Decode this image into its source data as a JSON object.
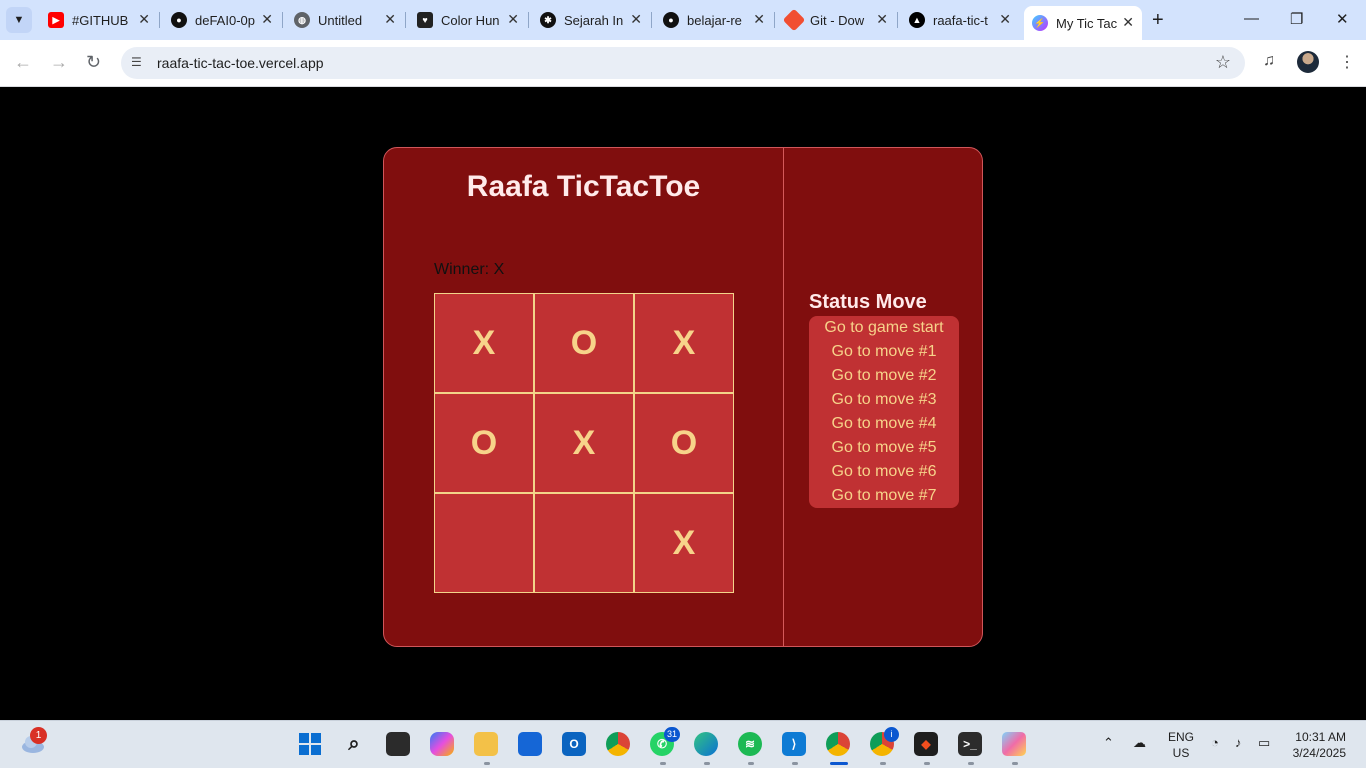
{
  "browser": {
    "tabs": [
      {
        "title": "#GITHUB",
        "icon": "youtube-icon",
        "color": "#ff0000"
      },
      {
        "title": "deFAI0-0p",
        "icon": "github-icon",
        "color": "#111111"
      },
      {
        "title": "Untitled",
        "icon": "globe-icon",
        "color": "#5f6368"
      },
      {
        "title": "Color Hun",
        "icon": "color-hunt-icon",
        "color": "#222222"
      },
      {
        "title": "Sejarah In",
        "icon": "chatgpt-icon",
        "color": "#111111"
      },
      {
        "title": "belajar-re",
        "icon": "github-icon",
        "color": "#111111"
      },
      {
        "title": "Git - Dow",
        "icon": "git-icon",
        "color": "#f14e32"
      },
      {
        "title": "raafa-tic-t",
        "icon": "vercel-icon",
        "color": "#000000"
      },
      {
        "title": "My Tic Tac",
        "icon": "vite-icon",
        "color": "#a855f7"
      }
    ],
    "url": "raafa-tic-tac-toe.vercel.app"
  },
  "game": {
    "title": "Raafa TicTacToe",
    "winner_label": "Winner:",
    "winner_value": "X",
    "board": [
      "X",
      "O",
      "X",
      "O",
      "X",
      "O",
      "",
      "",
      "X"
    ],
    "status_title": "Status Move",
    "moves": [
      "Go to game start",
      "Go to move #1",
      "Go to move #2",
      "Go to move #3",
      "Go to move #4",
      "Go to move #5",
      "Go to move #6",
      "Go to move #7"
    ],
    "colors": {
      "panel": "#800e0e",
      "cell": "#c03133",
      "cell_text": "#f7d38a",
      "cell_border": "#f3d48a"
    }
  },
  "taskbar": {
    "weather_badge": "1",
    "whatsapp_badge": "31",
    "chrome2_badge": "i",
    "lang_top": "ENG",
    "lang_bottom": "US",
    "time": "10:31 AM",
    "date": "3/24/2025"
  }
}
